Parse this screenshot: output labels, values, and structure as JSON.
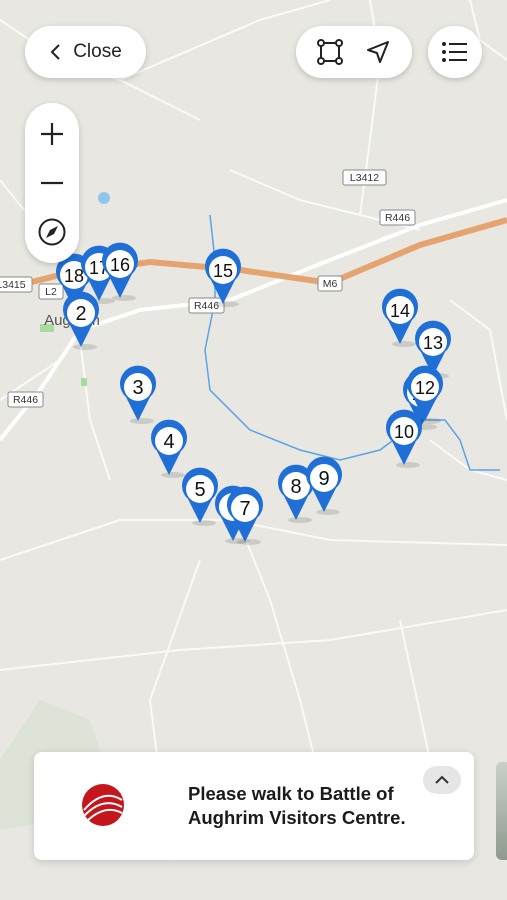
{
  "header": {
    "close_label": "Close"
  },
  "map": {
    "road_labels": {
      "l3412": "L3412",
      "r446_east": "R446",
      "r446_mid": "R446",
      "m6": "M6",
      "l3415": "L3415",
      "l2": "L2",
      "r446_west": "R446",
      "town": "Aughrim"
    },
    "markers": [
      {
        "id": "18",
        "label": "18"
      },
      {
        "id": "17",
        "label": "17"
      },
      {
        "id": "16",
        "label": "16"
      },
      {
        "id": "2",
        "label": "2"
      },
      {
        "id": "15",
        "label": "15"
      },
      {
        "id": "3",
        "label": "3"
      },
      {
        "id": "4",
        "label": "4"
      },
      {
        "id": "5",
        "label": "5"
      },
      {
        "id": "6",
        "label": "6"
      },
      {
        "id": "7",
        "label": "7"
      },
      {
        "id": "8",
        "label": "8"
      },
      {
        "id": "9",
        "label": "9"
      },
      {
        "id": "14",
        "label": "14"
      },
      {
        "id": "13",
        "label": "13"
      },
      {
        "id": "11",
        "label": "11"
      },
      {
        "id": "12",
        "label": "12"
      },
      {
        "id": "10",
        "label": "10"
      }
    ],
    "colors": {
      "marker": "#1f6fd6",
      "motorway": "#e5a46f",
      "river": "#5aa4e6"
    }
  },
  "card": {
    "message": "Please walk to Battle of Aughrim Visitors Centre."
  },
  "icons": {
    "close": "chevron-left-icon",
    "area": "square-select-icon",
    "locate": "navigation-arrow-icon",
    "list": "list-icon",
    "zoom_in": "plus-icon",
    "zoom_out": "minus-icon",
    "compass": "compass-icon",
    "expand": "chevron-up-icon"
  }
}
